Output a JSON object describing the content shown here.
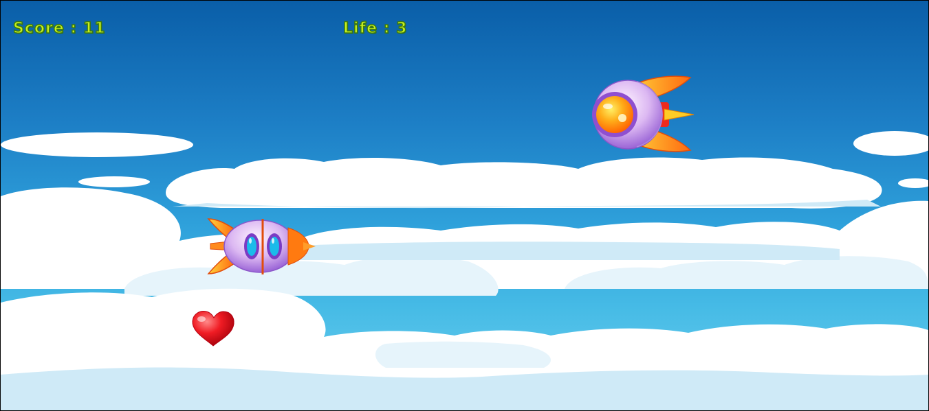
{
  "hud": {
    "score_text": "Score : 11",
    "life_text": "Life : 3"
  },
  "colors": {
    "hud_text": "#c8f01e",
    "sky_top": "#0a5ea8",
    "sky_bottom": "#6fd0ee",
    "cloud": "#ffffff",
    "cloud_shadow": "#cfeaf7",
    "heart": "#ee1c24",
    "ship_body": "#d9b3f2",
    "ship_window": "#18b7e8",
    "ship_fins": "#ff8a1c",
    "enemy_window": "#ff8a00"
  },
  "sprites": {
    "player": "rocket-ship",
    "enemy": "ufo-ship",
    "pickup": "heart"
  }
}
